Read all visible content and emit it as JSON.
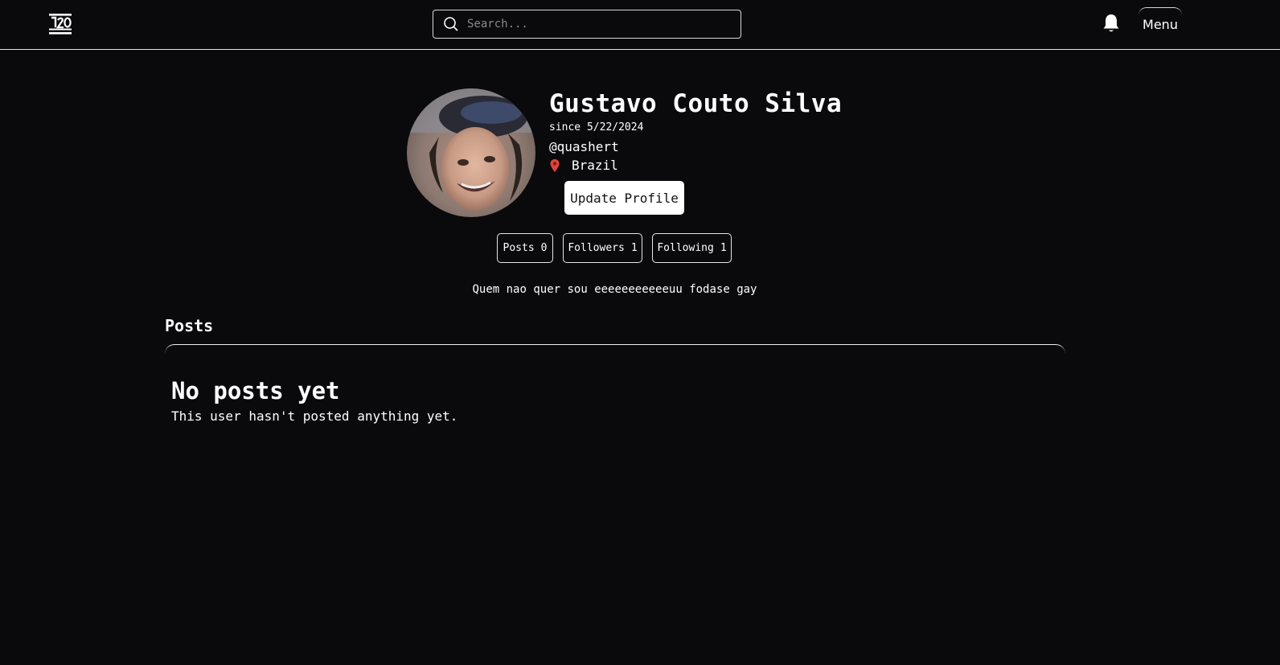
{
  "header": {
    "search_placeholder": "Search...",
    "menu_label": "Menu"
  },
  "profile": {
    "name": "Gustavo Couto Silva",
    "since": "since 5/22/2024",
    "handle": "@quashert",
    "location": "Brazil",
    "update_button": "Update Profile",
    "bio": "Quem nao quer sou eeeeeeeeeeeuu fodase gay"
  },
  "stats": {
    "posts_label": "Posts",
    "posts_count": "0",
    "followers_label": "Followers",
    "followers_count": "1",
    "following_label": "Following",
    "following_count": "1"
  },
  "posts": {
    "heading": "Posts",
    "empty_title": "No posts yet",
    "empty_text": "This user hasn't posted anything yet."
  },
  "icons": {
    "logo": "logo-icon",
    "search": "search-icon",
    "bell": "bell-icon",
    "pin": "pin-icon"
  },
  "colors": {
    "background": "#0a0a0c",
    "text": "#ffffff",
    "border": "#e6e6e6",
    "button_bg": "#ffffff",
    "pin": "#e0453b"
  }
}
